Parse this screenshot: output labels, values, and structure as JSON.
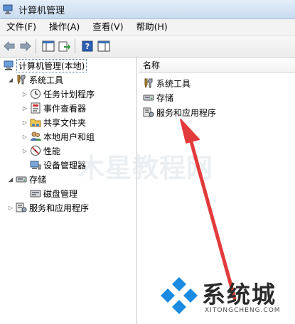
{
  "window": {
    "title": "计算机管理"
  },
  "menu": [
    "文件(F)",
    "操作(A)",
    "查看(V)",
    "帮助(H)"
  ],
  "tree": {
    "root": "计算机管理(本地)",
    "system_tools": "系统工具",
    "system_children": [
      "任务计划程序",
      "事件查看器",
      "共享文件夹",
      "本地用户和组",
      "性能",
      "设备管理器"
    ],
    "storage": "存储",
    "disk": "磁盘管理",
    "services": "服务和应用程序"
  },
  "list": {
    "header": "名称",
    "items": [
      "系统工具",
      "存储",
      "服务和应用程序"
    ]
  },
  "watermark": "木星教程网",
  "logo": {
    "name": "系统城",
    "url": "XITONGCHENG.COM"
  },
  "colors": {
    "arrow": "#e23b3b",
    "logo_blue": "#1a8be0",
    "selection_border": "#4d6e99"
  }
}
